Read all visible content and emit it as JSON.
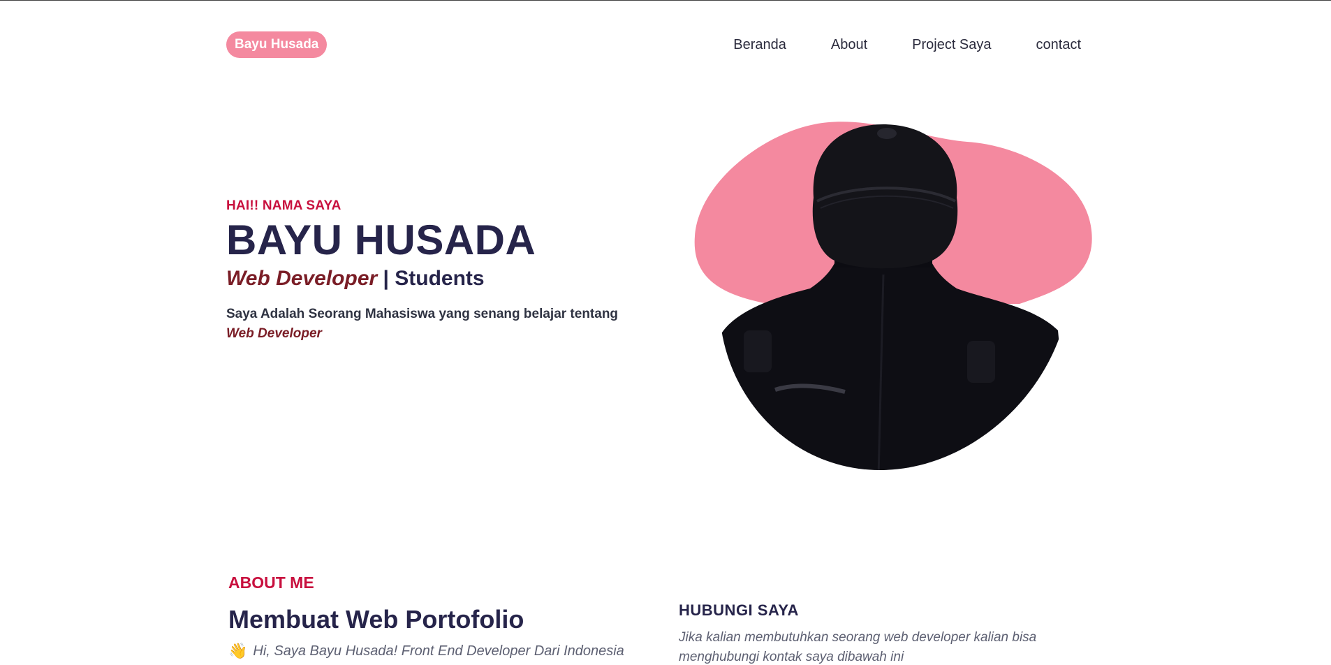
{
  "nav": {
    "brand": "Bayu Husada",
    "links": [
      "Beranda",
      "About",
      "Project Saya",
      "contact"
    ]
  },
  "hero": {
    "greeting": "HAI!! NAMA SAYA",
    "name": "BAYU HUSADA",
    "role_main": "Web Developer",
    "role_sep": " | ",
    "role_secondary": "Students",
    "desc": "Saya Adalah Seorang Mahasiswa yang senang belajar tentang",
    "desc_em": "Web Developer"
  },
  "about": {
    "kicker": "ABOUT ME",
    "title": "Membuat Web Portofolio",
    "intro": "Hi, Saya Bayu Husada! Front End Developer Dari Indonesia"
  },
  "contact": {
    "title": "HUBUNGI SAYA",
    "desc": "Jika kalian membutuhkan seorang web developer kalian bisa menghubungi kontak saya dibawah ini"
  },
  "colors": {
    "accent_pink": "#f4899f",
    "accent_red": "#c8103e",
    "dark_navy": "#26244a",
    "maroon": "#7a1d26"
  }
}
